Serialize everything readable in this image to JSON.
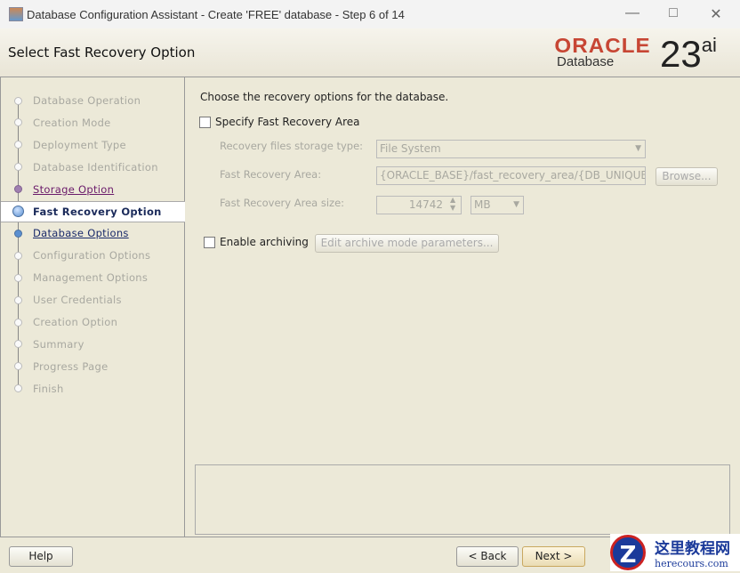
{
  "window": {
    "title": "Database Configuration Assistant - Create 'FREE' database - Step 6 of 14"
  },
  "header": {
    "title": "Select Fast Recovery Option",
    "logo_brand": "ORACLE",
    "logo_product": "Database",
    "logo_version": "23",
    "logo_suffix": "ai"
  },
  "steps": [
    {
      "label": "Database Operation",
      "state": "pending"
    },
    {
      "label": "Creation Mode",
      "state": "pending"
    },
    {
      "label": "Deployment Type",
      "state": "pending"
    },
    {
      "label": "Database Identification",
      "state": "pending"
    },
    {
      "label": "Storage Option",
      "state": "done"
    },
    {
      "label": "Fast Recovery Option",
      "state": "current"
    },
    {
      "label": "Database Options",
      "state": "next"
    },
    {
      "label": "Configuration Options",
      "state": "pending"
    },
    {
      "label": "Management Options",
      "state": "pending"
    },
    {
      "label": "User Credentials",
      "state": "pending"
    },
    {
      "label": "Creation Option",
      "state": "pending"
    },
    {
      "label": "Summary",
      "state": "pending"
    },
    {
      "label": "Progress Page",
      "state": "pending"
    },
    {
      "label": "Finish",
      "state": "pending"
    }
  ],
  "content": {
    "intro": "Choose the recovery options for the database.",
    "specify_fra_label": "Specify Fast Recovery Area",
    "specify_fra_checked": false,
    "storage_type_label": "Recovery files storage type:",
    "storage_type_value": "File System",
    "fra_label": "Fast Recovery Area:",
    "fra_value": "{ORACLE_BASE}/fast_recovery_area/{DB_UNIQUE_",
    "browse_label": "Browse...",
    "fra_size_label": "Fast Recovery Area size:",
    "fra_size_value": "14742",
    "fra_size_unit": "MB",
    "enable_archiving_label": "Enable archiving",
    "enable_archiving_checked": false,
    "edit_archive_label": "Edit archive mode parameters..."
  },
  "footer": {
    "help": "Help",
    "back": "< Back",
    "next": "Next >"
  },
  "watermark": {
    "text": "这里教程网",
    "url": "herecours.com"
  }
}
